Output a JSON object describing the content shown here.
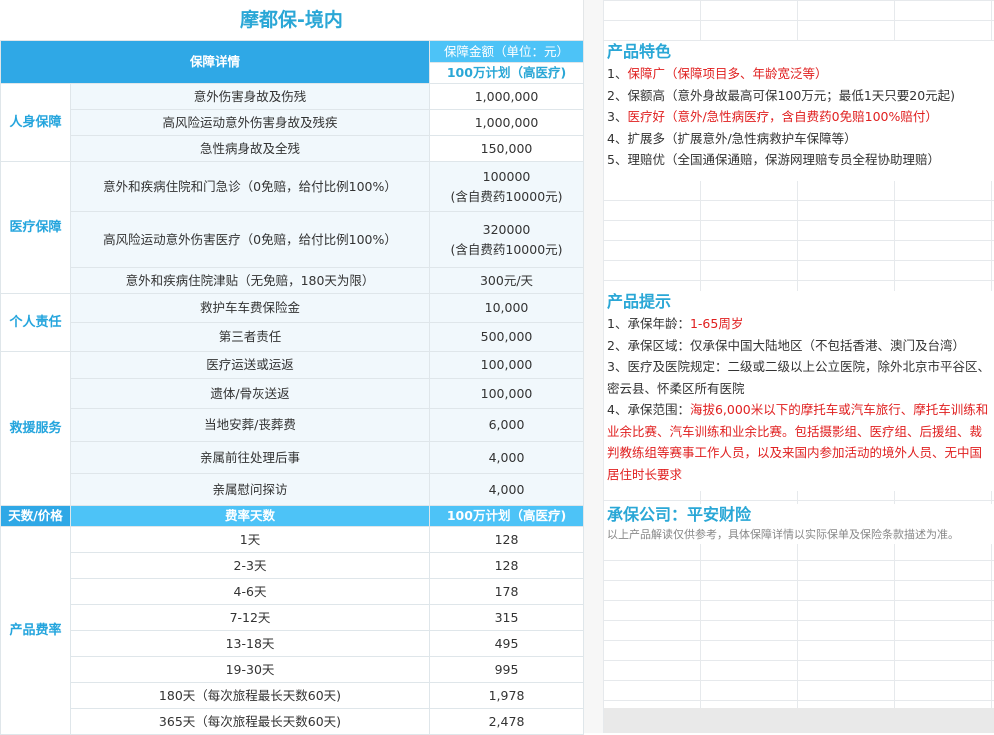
{
  "title": "摩都保-境内",
  "header": {
    "details": "保障详情",
    "amount": "保障金额（单位：元）",
    "plan": "100万计划（高医疗)"
  },
  "sections": {
    "personal": "人身保障",
    "medical": "医疗保障",
    "liability": "个人责任",
    "rescue": "救援服务"
  },
  "rows": [
    {
      "item": "意外伤害身故及伤残",
      "val": "1,000,000"
    },
    {
      "item": "高风险运动意外伤害身故及残疾",
      "val": "1,000,000"
    },
    {
      "item": "急性病身故及全残",
      "val": "150,000"
    },
    {
      "item": "意外和疾病住院和门急诊（0免赔，给付比例100%）",
      "val": "100000",
      "val2": "(含自费药10000元)"
    },
    {
      "item": "高风险运动意外伤害医疗（0免赔，给付比例100%）",
      "val": "320000",
      "val2": "(含自费药10000元)"
    },
    {
      "item": "意外和疾病住院津贴（无免赔，180天为限）",
      "val": "300元/天"
    },
    {
      "item": "救护车车费保险金",
      "val": "10,000"
    },
    {
      "item": "第三者责任",
      "val": "500,000"
    },
    {
      "item": "医疗运送或运返",
      "val": "100,000"
    },
    {
      "item": "遗体/骨灰送返",
      "val": "100,000"
    },
    {
      "item": "当地安葬/丧葬费",
      "val": "6,000"
    },
    {
      "item": "亲属前往处理后事",
      "val": "4,000"
    },
    {
      "item": "亲属慰问探访",
      "val": "4,000"
    }
  ],
  "price_header": {
    "days_price": "天数/价格",
    "rate_days": "费率天数",
    "plan": "100万计划（高医疗)"
  },
  "price_section": "产品费率",
  "prices": [
    {
      "days": "1天",
      "price": "128"
    },
    {
      "days": "2-3天",
      "price": "128"
    },
    {
      "days": "4-6天",
      "price": "178"
    },
    {
      "days": "7-12天",
      "price": "315"
    },
    {
      "days": "13-18天",
      "price": "495"
    },
    {
      "days": "19-30天",
      "price": "995"
    },
    {
      "days": "180天（每次旅程最长天数60天)",
      "price": "1,978"
    },
    {
      "days": "365天（每次旅程最长天数60天)",
      "price": "2,478"
    }
  ],
  "features": {
    "heading": "产品特色",
    "items": [
      {
        "prefix": "1、",
        "text": "保障广（保障项目多、年龄宽泛等）",
        "red": true
      },
      {
        "prefix": "2、",
        "text": "保额高（意外身故最高可保100万元；最低1天只要20元起)",
        "red": false
      },
      {
        "prefix": "3、",
        "text": "医疗好（意外/急性病医疗，含自费药0免赔100%赔付）",
        "red": true
      },
      {
        "prefix": "4、",
        "text": "扩展多（扩展意外/急性病救护车保障等）",
        "red": false
      },
      {
        "prefix": "5、",
        "text": "理赔优（全国通保通赔，保游网理赔专员全程协助理赔）",
        "red": false
      }
    ]
  },
  "tips": {
    "heading": "产品提示",
    "age_label": "1、承保年龄：",
    "age_value": "1-65周岁",
    "region": "2、承保区域：仅承保中国大陆地区（不包括香港、澳门及台湾）",
    "hospital": "3、医疗及医院规定：二级或二级以上公立医院，除外北京市平谷区、密云县、怀柔区所有医院",
    "scope_label": "4、承保范围：",
    "scope_value": "海拔6,000米以下的摩托车或汽车旅行、摩托车训练和业余比赛、汽车训练和业余比赛。包括摄影组、医疗组、后援组、裁判教练组等赛事工作人员，以及来国内参加活动的境外人员、无中国居住时长要求"
  },
  "insurer": {
    "heading": "承保公司：平安财险",
    "note": "以上产品解读仅供参考，具体保障详情以实际保单及保险条款描述为准。"
  }
}
